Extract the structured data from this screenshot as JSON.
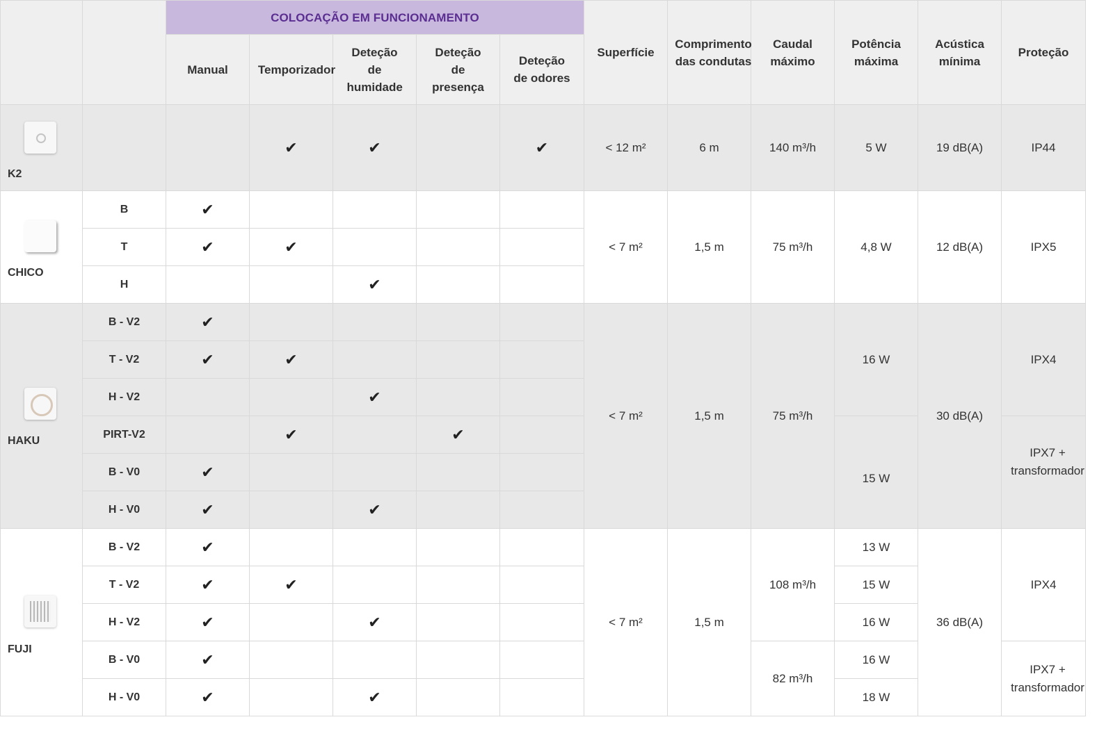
{
  "header": {
    "group_title": "COLOCAÇÃO EM FUNCIONAMENTO",
    "modes": [
      "Manual",
      "Temporizador",
      "Deteção de humidade",
      "Deteção de presença",
      "Deteção de odores"
    ],
    "specs": [
      "Superfície",
      "Comprimento das condutas",
      "Caudal máximo",
      "Potência máxima",
      "Acústica mínima",
      "Proteção"
    ]
  },
  "check_mark": "✔",
  "products": {
    "k2": {
      "name": "K2",
      "checks": [
        "",
        "✔",
        "✔",
        "",
        "✔"
      ],
      "surface": "< 12 m²",
      "duct": "6 m",
      "flow": "140 m³/h",
      "power": "5 W",
      "acoustic": "19 dB(A)",
      "protection": "IP44"
    },
    "chico": {
      "name": "CHICO",
      "variants": [
        {
          "label": "B",
          "checks": [
            "✔",
            "",
            "",
            "",
            ""
          ]
        },
        {
          "label": "T",
          "checks": [
            "✔",
            "✔",
            "",
            "",
            ""
          ]
        },
        {
          "label": "H",
          "checks": [
            "",
            "",
            "✔",
            "",
            ""
          ]
        }
      ],
      "surface": "< 7 m²",
      "duct": "1,5 m",
      "flow": "75 m³/h",
      "power": "4,8 W",
      "acoustic": "12 dB(A)",
      "protection": "IPX5"
    },
    "haku": {
      "name": "HAKU",
      "variants": [
        {
          "label": "B - V2",
          "checks": [
            "✔",
            "",
            "",
            "",
            ""
          ]
        },
        {
          "label": "T - V2",
          "checks": [
            "✔",
            "✔",
            "",
            "",
            ""
          ]
        },
        {
          "label": "H - V2",
          "checks": [
            "",
            "",
            "✔",
            "",
            ""
          ]
        },
        {
          "label": "PIRT-V2",
          "checks": [
            "",
            "✔",
            "",
            "✔",
            ""
          ]
        },
        {
          "label": "B - V0",
          "checks": [
            "✔",
            "",
            "",
            "",
            ""
          ]
        },
        {
          "label": "H - V0",
          "checks": [
            "✔",
            "",
            "✔",
            "",
            ""
          ]
        }
      ],
      "surface": "< 7 m²",
      "duct": "1,5 m",
      "flow": "75 m³/h",
      "power_v2": "16 W",
      "power_v0": "15 W",
      "acoustic": "30 dB(A)",
      "protection_v2": "IPX4",
      "protection_v0": "IPX7 + transformador"
    },
    "fuji": {
      "name": "FUJI",
      "variants": [
        {
          "label": "B - V2",
          "checks": [
            "✔",
            "",
            "",
            "",
            ""
          ],
          "power": "13 W"
        },
        {
          "label": "T - V2",
          "checks": [
            "✔",
            "✔",
            "",
            "",
            ""
          ],
          "power": "15 W"
        },
        {
          "label": "H - V2",
          "checks": [
            "✔",
            "",
            "✔",
            "",
            ""
          ],
          "power": "16 W"
        },
        {
          "label": "B - V0",
          "checks": [
            "✔",
            "",
            "",
            "",
            ""
          ],
          "power": "16 W"
        },
        {
          "label": "H - V0",
          "checks": [
            "✔",
            "",
            "✔",
            "",
            ""
          ],
          "power": "18 W"
        }
      ],
      "surface": "< 7 m²",
      "duct": "1,5 m",
      "flow_v2": "108 m³/h",
      "flow_v0": "82 m³/h",
      "acoustic": "36 dB(A)",
      "protection_v2": "IPX4",
      "protection_v0": "IPX7 + transformador"
    }
  }
}
